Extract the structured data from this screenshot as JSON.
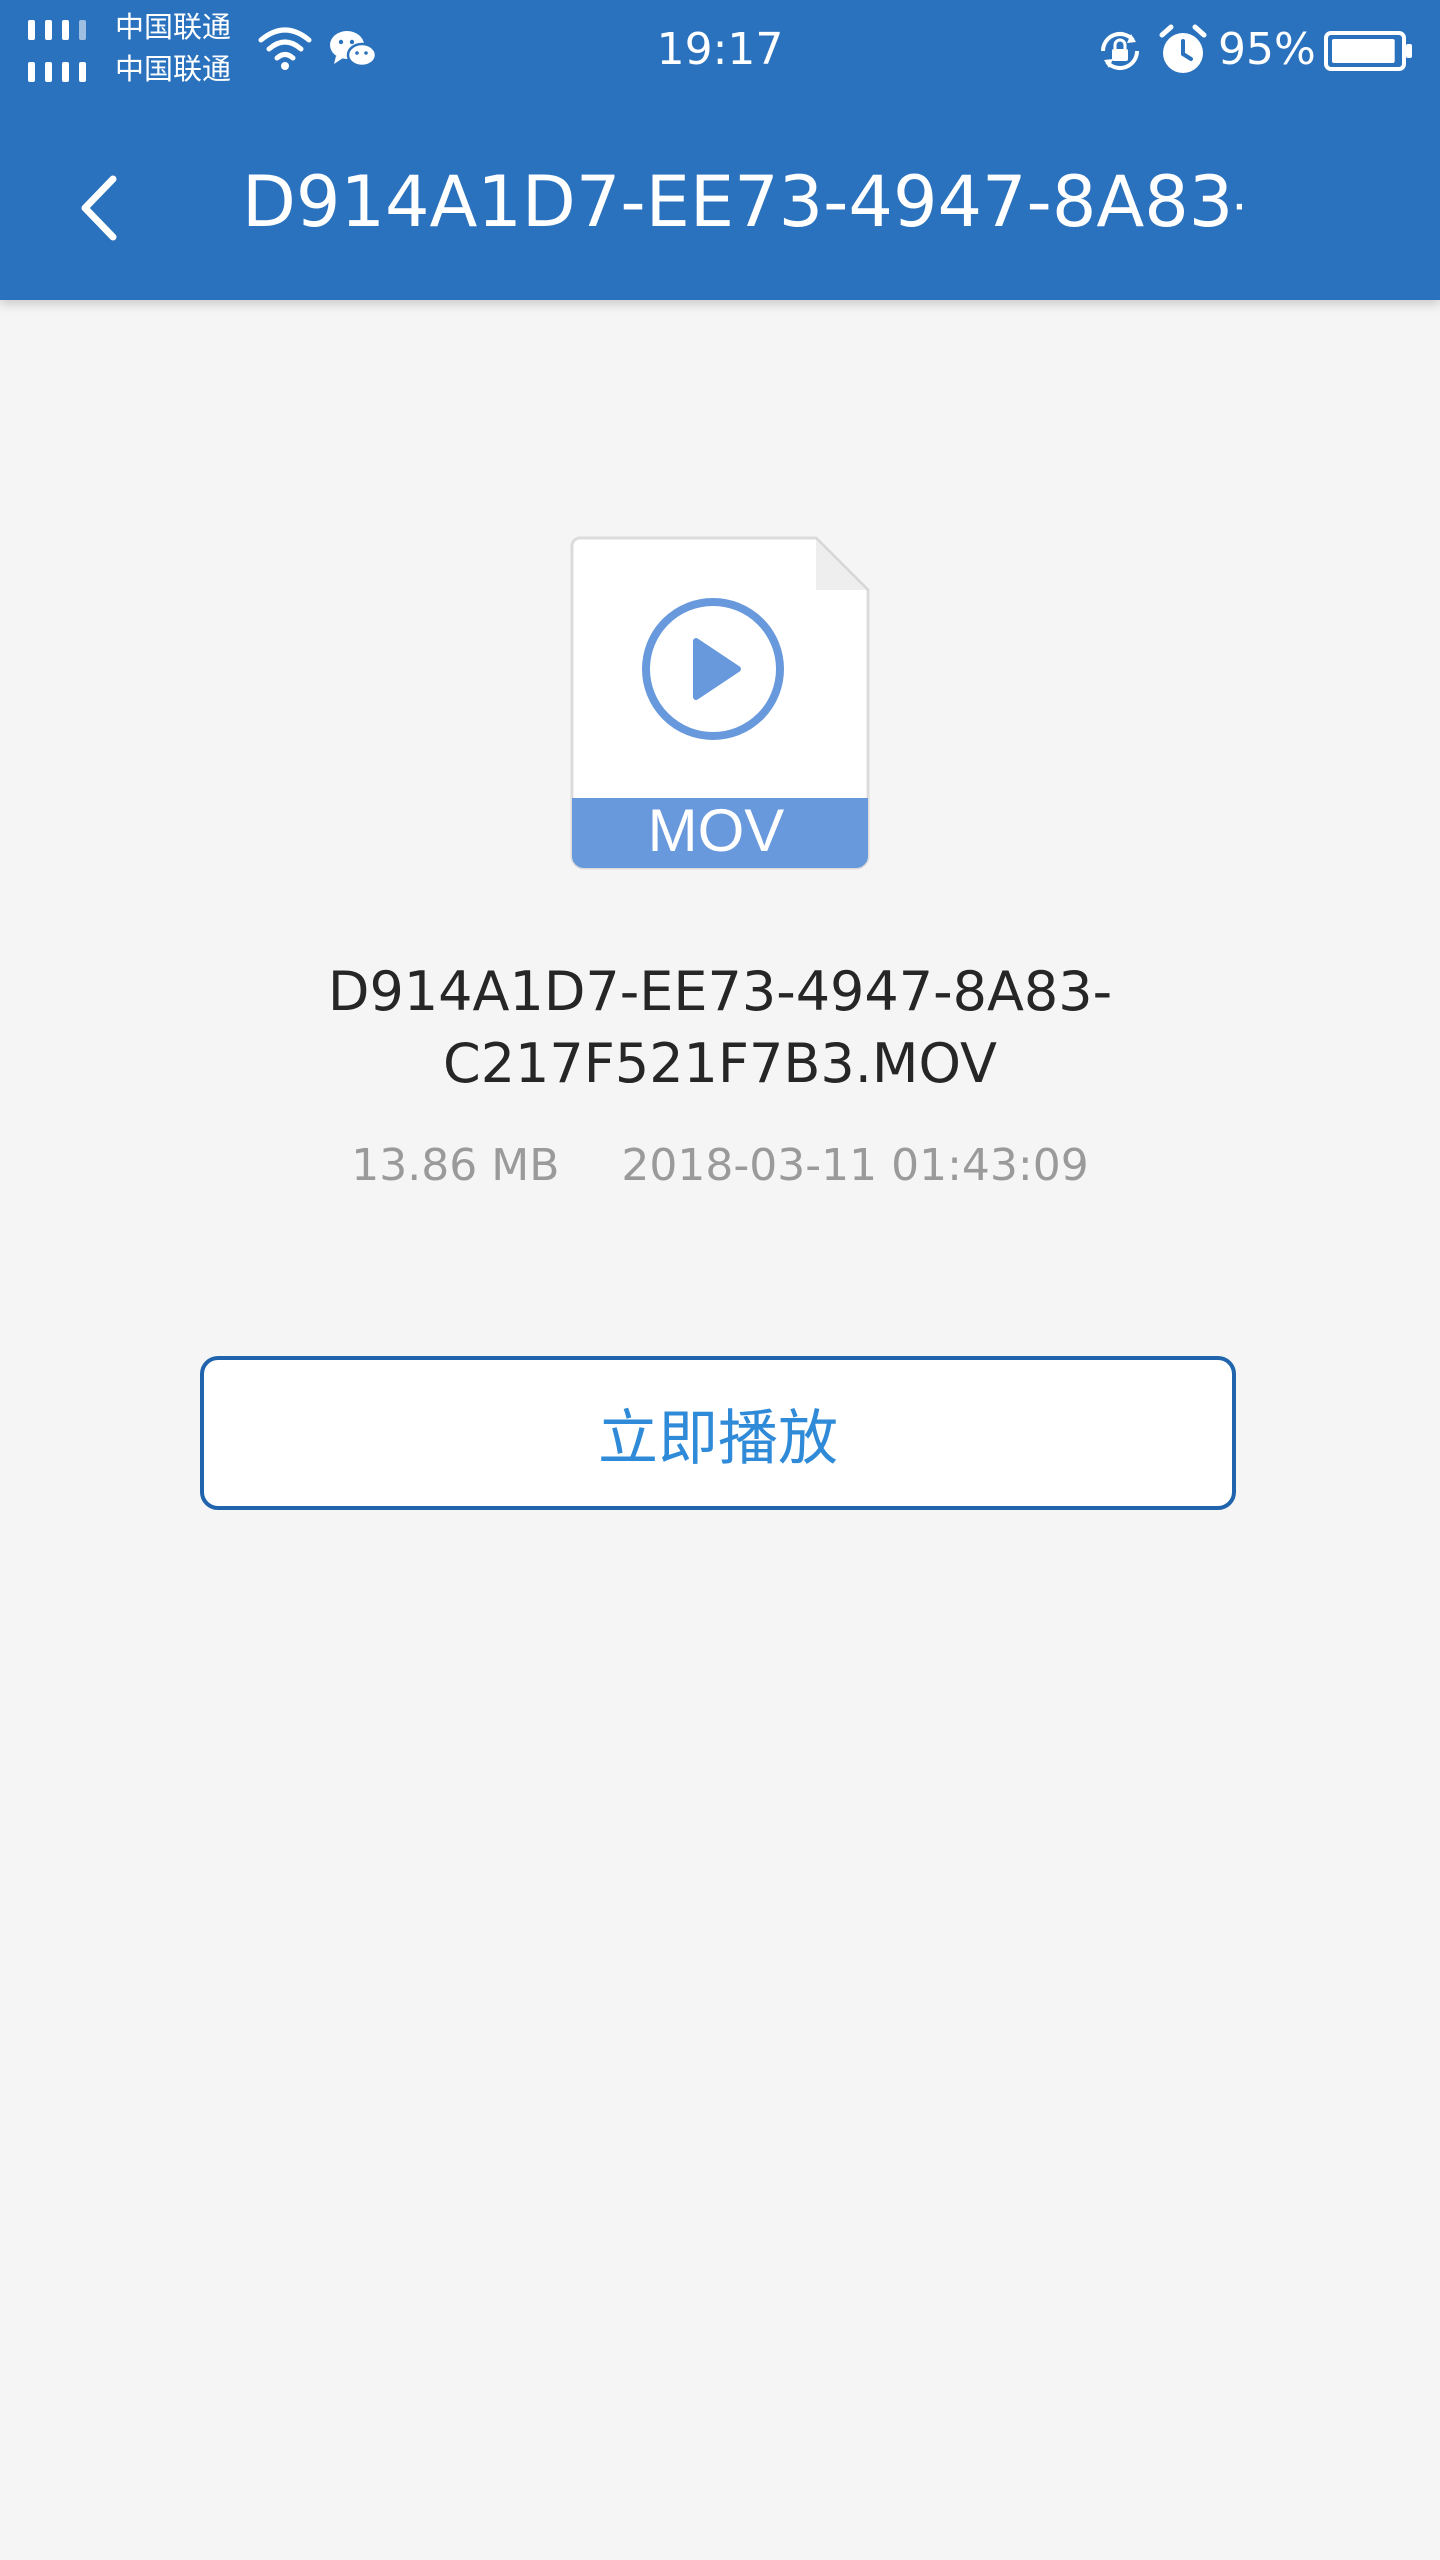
{
  "status_bar": {
    "carrier_1": "中国联通",
    "carrier_2": "中国联通",
    "time": "19:17",
    "battery_percent": "95%",
    "battery_level": 0.95,
    "icons": [
      "signal-icon",
      "wifi-icon",
      "wechat-icon",
      "rotation-lock-icon",
      "alarm-icon",
      "battery-icon"
    ]
  },
  "header": {
    "title": "D914A1D7-EE73-4947-8A83-…",
    "back_icon": "chevron-left-icon"
  },
  "file": {
    "type_label": "MOV",
    "name_line_1": "D914A1D7-EE73-4947-8A83-",
    "name_line_2": "C217F521F7B3.MOV",
    "size": "13.86 MB",
    "modified": "2018-03-11 01:43:09",
    "icon": "video-file-icon"
  },
  "actions": {
    "play_label": "立即播放"
  },
  "colors": {
    "header_bg": "#2a72be",
    "page_bg": "#f5f5f5",
    "accent": "#2f8ad8",
    "button_border": "#1f64ad",
    "file_band": "#6899dc"
  }
}
